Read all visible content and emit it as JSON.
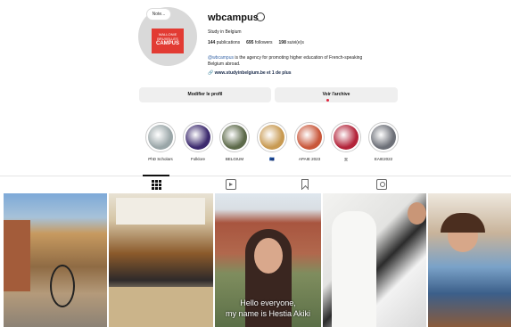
{
  "profile": {
    "note": "Note...",
    "avatar_logo_line1": "WALLONIE",
    "avatar_logo_line2": "BRUXELLES",
    "avatar_logo_line3": "CAMPUS",
    "username": "wbcampus",
    "full_name": "Study in Belgium",
    "posts_count": "144",
    "posts_label": "publications",
    "followers_count": "695",
    "followers_label": "followers",
    "following_count": "198",
    "following_label": "suivi(e)s",
    "bio_mention": "@wbcampus",
    "bio_line1": " is the agency for promoting higher education of French-speaking",
    "bio_line2": "Belgium abroad.",
    "link": "www.studyinbelgium.be et 1 de plus"
  },
  "actions": {
    "edit_profile": "Modifier le profil",
    "archive": "Voir l'archive"
  },
  "highlights": [
    {
      "label": "PhD Scholars",
      "color": "#9aa6a8"
    },
    {
      "label": "Folklore",
      "color": "#3c2a6e"
    },
    {
      "label": "BELGIUM",
      "color": "#5d6a4a"
    },
    {
      "label": "🇪🇺",
      "color": "#c89a52"
    },
    {
      "label": "APAIE 2023",
      "color": "#c9573a"
    },
    {
      "label": "🇦",
      "color": "#b3243a"
    },
    {
      "label": "EAIE2022",
      "color": "#6d7078"
    }
  ],
  "tabs": {
    "posts_icon": "grid-icon",
    "reels_icon": "reels-icon",
    "saved_icon": "bookmark-icon",
    "tagged_icon": "tagged-icon"
  },
  "posts": [
    {
      "caption": ""
    },
    {
      "caption": ""
    },
    {
      "caption_line1": "Hello everyone,",
      "caption_line2": "my name is Hestia Akiki"
    },
    {
      "caption": ""
    },
    {
      "caption": ""
    }
  ]
}
